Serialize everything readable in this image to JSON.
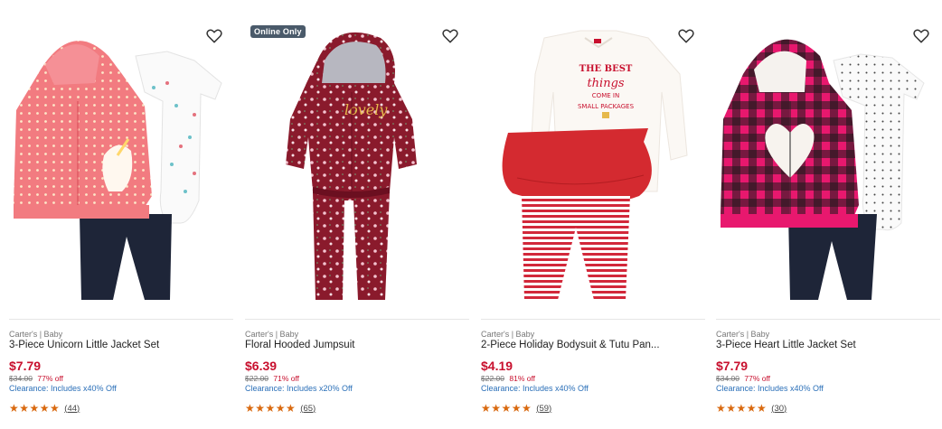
{
  "colors": {
    "price": "#c8102e",
    "discount": "#c8102e",
    "clearance": "#2a6fb8",
    "stars": "#d9690f",
    "badge": "#4a5a6a"
  },
  "products": [
    {
      "brand": "Carter's | Baby",
      "title": "3-Piece Unicorn Little Jacket Set",
      "price": "$7.79",
      "was_price": "$34.00",
      "discount": "77% off",
      "clearance": "Clearance: Includes x40% Off",
      "stars": "★★★★★",
      "rating": 5,
      "review_count": "(44)",
      "favorite_icon": "heart-outline-icon"
    },
    {
      "badge": "Online Only",
      "brand": "Carter's | Baby",
      "title": "Floral Hooded Jumpsuit",
      "price": "$6.39",
      "was_price": "$22.00",
      "discount": "71% off",
      "clearance": "Clearance: Includes x20% Off",
      "stars": "★★★★★",
      "rating": 5,
      "review_count": "(65)",
      "favorite_icon": "heart-outline-icon"
    },
    {
      "brand": "Carter's | Baby",
      "title": "2-Piece Holiday Bodysuit & Tutu Pan...",
      "price": "$4.19",
      "was_price": "$22.00",
      "discount": "81% off",
      "clearance": "Clearance: Includes x40% Off",
      "stars": "★★★★★",
      "rating": 5,
      "review_count": "(59)",
      "favorite_icon": "heart-outline-icon",
      "image_text": [
        "THE BEST",
        "things",
        "COME IN",
        "SMALL PACKAGES"
      ]
    },
    {
      "brand": "Carter's | Baby",
      "title": "3-Piece Heart Little Jacket Set",
      "price": "$7.79",
      "was_price": "$34.00",
      "discount": "77% off",
      "clearance": "Clearance: Includes x40% Off",
      "stars": "★★★★★",
      "rating": 5,
      "review_count": "(30)",
      "favorite_icon": "heart-outline-icon"
    }
  ]
}
